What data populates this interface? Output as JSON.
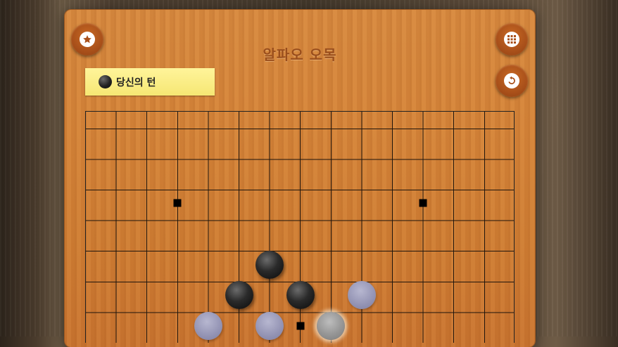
{
  "game": {
    "title": "알파오 오목",
    "turn_label": "당신의 턴",
    "turn_stone": "black"
  },
  "buttons": {
    "favorite": "star-icon",
    "menu": "grid-icon",
    "undo": "undo-icon"
  },
  "board": {
    "columns_visible": 14,
    "rows_visible": 8,
    "star_points": [
      {
        "col": 3,
        "row": 3
      },
      {
        "col": 11,
        "row": 3
      },
      {
        "col": 7,
        "row": 7
      }
    ],
    "stones": [
      {
        "col": 6,
        "row": 5,
        "kind": "black"
      },
      {
        "col": 5,
        "row": 6,
        "kind": "black"
      },
      {
        "col": 7,
        "row": 6,
        "kind": "black"
      },
      {
        "col": 9,
        "row": 6,
        "kind": "ghost"
      },
      {
        "col": 4,
        "row": 7,
        "kind": "ghost"
      },
      {
        "col": 6,
        "row": 7,
        "kind": "ghost"
      },
      {
        "col": 8,
        "row": 7,
        "kind": "gray"
      }
    ]
  },
  "colors": {
    "panel_wood": "#d58439",
    "title_text": "#9a4e1c",
    "turn_box": "#f6e774",
    "button_brown": "#a9501a"
  }
}
